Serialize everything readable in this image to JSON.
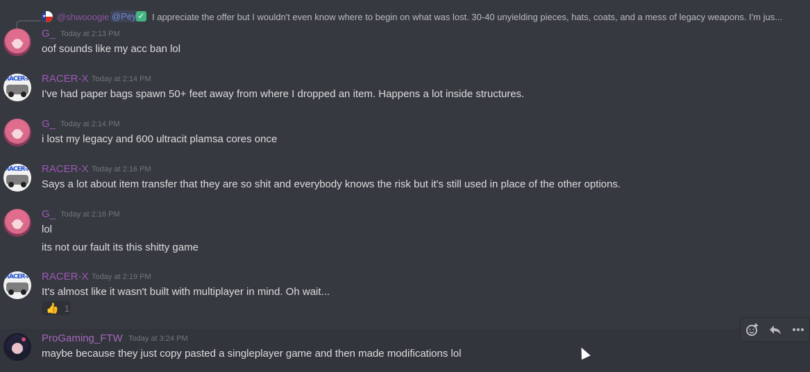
{
  "reply": {
    "author": "@shwooogie",
    "mention": "@Pey",
    "verified_icon": "check-mark-icon",
    "text": "I appreciate the offer but I wouldn't even know where to begin on what was lost. 30-40 unyielding pieces, hats, coats, and a mess of legacy weapons. I'm jus..."
  },
  "messages": [
    {
      "author": "G_",
      "time": "Today at 2:13 PM",
      "lines": [
        "oof sounds like my acc ban lol"
      ]
    },
    {
      "author": "RACER-X",
      "time": "Today at 2:14 PM",
      "lines": [
        "I've had paper bags spawn 50+ feet away from where I dropped an item. Happens a lot inside structures."
      ]
    },
    {
      "author": "G_",
      "time": "Today at 2:14 PM",
      "lines": [
        "i lost my legacy and 600 ultracit plamsa cores once"
      ]
    },
    {
      "author": "RACER-X",
      "time": "Today at 2:16 PM",
      "lines": [
        "Says a lot about item transfer that they are so shit and everybody knows the risk but it's still used in place of the other options."
      ]
    },
    {
      "author": "G_",
      "time": "Today at 2:16 PM",
      "lines": [
        "lol",
        "its not our fault its this shitty game"
      ]
    },
    {
      "author": "RACER-X",
      "time": "Today at 2:19 PM",
      "lines": [
        "It's almost like it wasn't built with multiplayer in mind. Oh wait..."
      ],
      "reaction": {
        "emoji": "👍",
        "count": "1"
      }
    },
    {
      "author": "ProGaming_FTW",
      "time": "Today at 3:24 PM",
      "lines": [
        "maybe because they just copy pasted a singleplayer game and then made modifications lol"
      ]
    }
  ],
  "toolbar": {
    "add_reaction_icon": "add-reaction-icon",
    "reply_icon": "reply-icon",
    "more_icon": "more-options-icon"
  },
  "colors": {
    "background": "#36393f",
    "username": "#9b59b6",
    "text": "#dcddde",
    "timestamp": "#72767d"
  }
}
